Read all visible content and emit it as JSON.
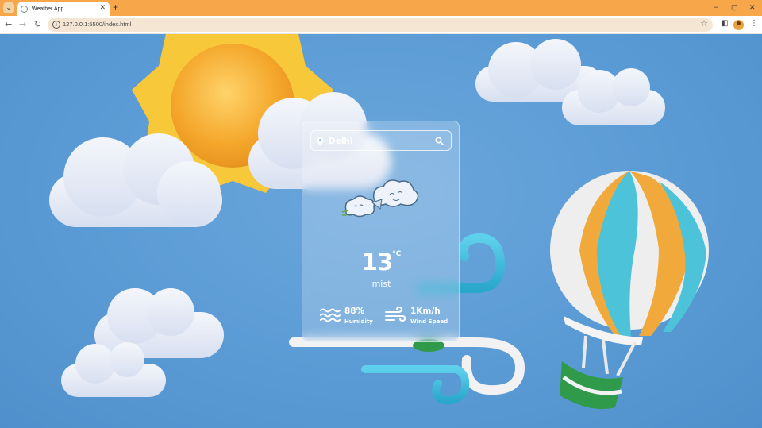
{
  "browser": {
    "tab_title": "Weather App",
    "tab_close": "✕",
    "new_tab": "+",
    "url": "127.0.0.1:5500/index.html",
    "window_controls": [
      "−",
      "▢",
      "✕"
    ]
  },
  "weather": {
    "search_value": "Delhi",
    "temperature": "13",
    "unit": "°C",
    "condition": "mist",
    "humidity_value": "88%",
    "humidity_label": "Humidity",
    "wind_value": "1Km/h",
    "wind_label": "Wind Speed"
  },
  "icons": {
    "location": "map-pin-icon",
    "search": "search-icon",
    "weather": "wind-cloud-icon",
    "humidity": "waves-icon",
    "wind": "wind-icon"
  },
  "colors": {
    "sky": "#5b9bd5",
    "tabbar": "#f7a64a",
    "sun": "#f5c33b",
    "cloud": "#e9eef7",
    "balloon_orange": "#f0a93a",
    "balloon_teal": "#4cc3d9",
    "basket_green": "#2e9a4a",
    "text": "#ffffff"
  }
}
